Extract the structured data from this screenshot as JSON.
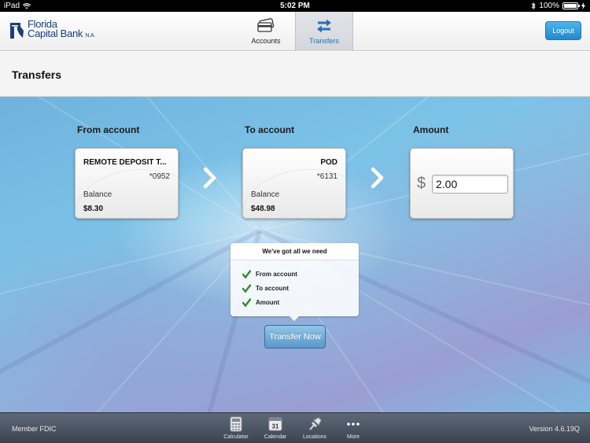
{
  "status_bar": {
    "device": "iPad",
    "time": "5:02 PM",
    "battery": "100%"
  },
  "header": {
    "logo_line1": "Florida",
    "logo_line2": "Capital Bank",
    "logo_suffix": "N.A.",
    "tabs": [
      {
        "label": "Accounts",
        "icon": "cards-icon",
        "active": false
      },
      {
        "label": "Transfers",
        "icon": "transfer-arrows-icon",
        "active": true
      }
    ],
    "logout_label": "Logout"
  },
  "page": {
    "title": "Transfers"
  },
  "transfer": {
    "from_label": "From account",
    "to_label": "To account",
    "amount_label": "Amount",
    "from_account": {
      "name": "REMOTE DEPOSIT T...",
      "number": "*0952",
      "balance_label": "Balance",
      "balance": "$8.30"
    },
    "to_account": {
      "name": "POD",
      "number": "*6131",
      "balance_label": "Balance",
      "balance": "$48.98"
    },
    "currency_symbol": "$",
    "amount_value": "2.00"
  },
  "checklist": {
    "title": "We've got all we need",
    "items": [
      "From account",
      "To account",
      "Amount"
    ]
  },
  "transfer_button": "Transfer Now",
  "footer": {
    "left_text": "Member FDIC",
    "version": "Version 4.6.19Q",
    "items": [
      {
        "label": "Calculator",
        "icon": "calculator-icon"
      },
      {
        "label": "Calendar",
        "icon": "calendar-icon",
        "badge": "31"
      },
      {
        "label": "Locations",
        "icon": "pin-icon"
      },
      {
        "label": "More",
        "icon": "more-dots-icon"
      }
    ]
  },
  "colors": {
    "accent": "#2a6fb8",
    "logout_bg": "#2188cf",
    "check_green": "#2e8b2e",
    "brand": "#1a3f7a"
  }
}
